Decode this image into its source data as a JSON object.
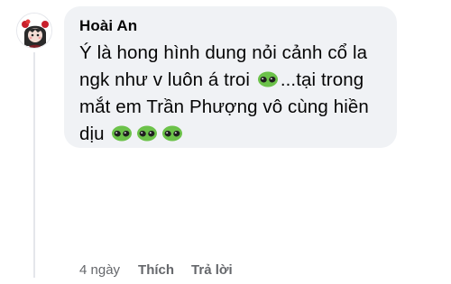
{
  "comment": {
    "author": "Hoài An",
    "text_part1": "Ý là hong hình dung nỏi cảnh cổ la ngk như v luôn á troi",
    "text_part2": "...tại trong mắt em Trần Phượng vô cùng hiền dịu",
    "emoji_name": "alien-face-emoji"
  },
  "actions": {
    "time": "4 ngày",
    "like_label": "Thích",
    "reply_label": "Trả lời"
  },
  "colors": {
    "bubble": "#f0f2f5",
    "secondary_text": "#65676b",
    "emoji_green": "#6cc24a"
  }
}
